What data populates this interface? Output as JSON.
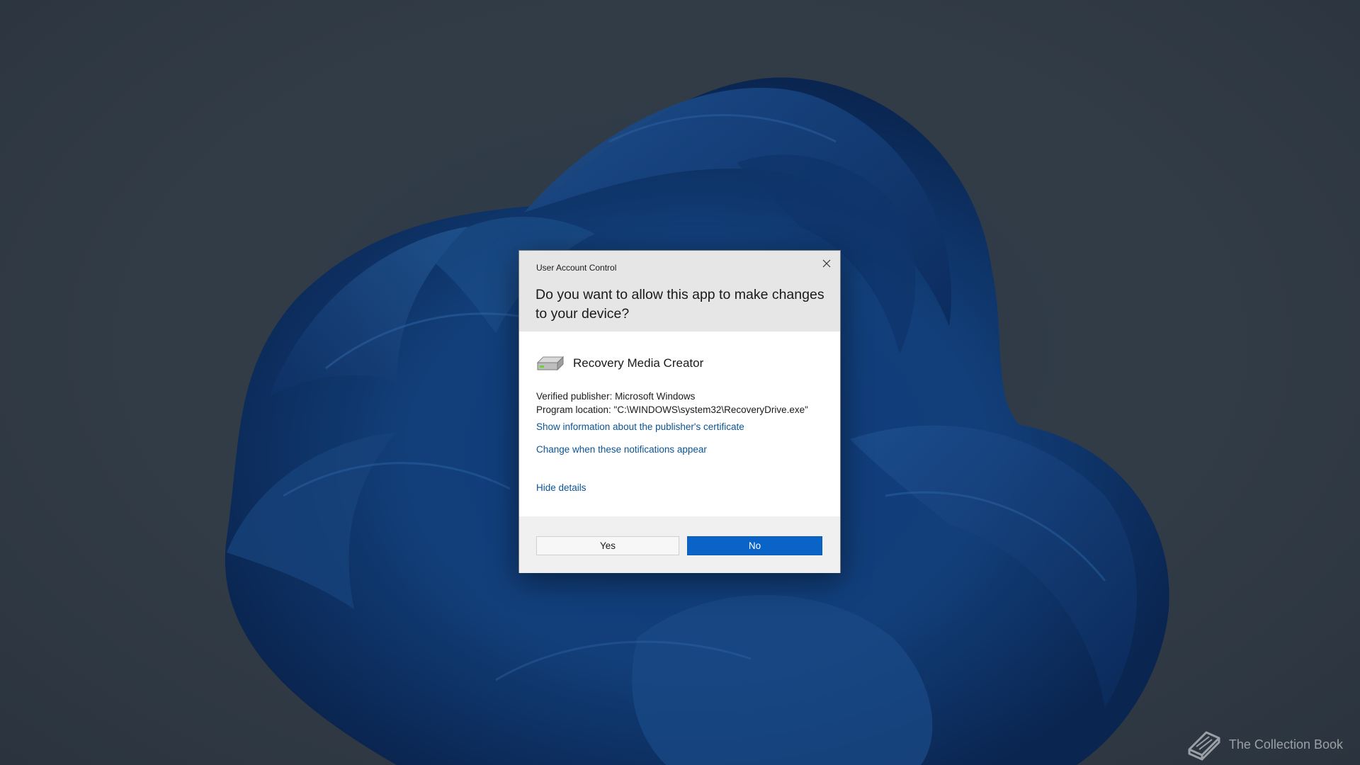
{
  "dialog": {
    "window_title": "User Account Control",
    "question": "Do you want to allow this app to make changes to your device?",
    "app_name": "Recovery Media Creator",
    "app_icon": "drive-icon",
    "publisher_line": "Verified publisher: Microsoft Windows",
    "location_line": "Program location: \"C:\\WINDOWS\\system32\\RecoveryDrive.exe\"",
    "cert_link": "Show information about the publisher's certificate",
    "notifications_link": "Change when these notifications appear",
    "hide_details_link": "Hide details",
    "yes_label": "Yes",
    "no_label": "No"
  },
  "watermark": {
    "text": "The Collection Book",
    "icon": "book-icon"
  },
  "colors": {
    "accent": "#0a64c8",
    "link": "#0b5394",
    "header_bg": "#e6e6e6",
    "footer_bg": "#f0f0f0"
  }
}
